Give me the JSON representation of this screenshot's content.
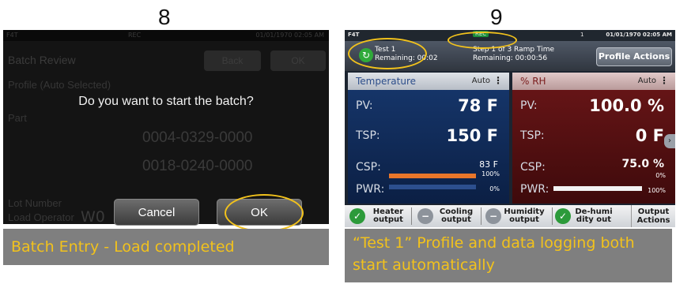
{
  "steps": {
    "left": "8",
    "right": "9"
  },
  "left_panel": {
    "status": {
      "app": "F4T",
      "rec": "REC",
      "datetime": "01/01/1970 02:05 AM"
    },
    "title": "Batch Review",
    "back_label": "Back",
    "ok_bg_label": "OK",
    "fields": {
      "profile_label": "Profile (Auto Selected)",
      "part_label": "Part",
      "part_value_1": "0004-0329-0000",
      "part_value_2": "0018-0240-0000",
      "lot_label": "Lot Number",
      "lot_value": "W0",
      "operator_label": "Load Operator"
    },
    "dialog": {
      "question": "Do you want to start the batch?",
      "cancel_label": "Cancel",
      "ok_label": "OK"
    },
    "caption": "Batch Entry - Load completed"
  },
  "right_panel": {
    "status": {
      "app": "F4T",
      "rec": "REC",
      "usb": "1",
      "datetime": "01/01/1970 02:05 AM"
    },
    "profile": {
      "name": "Test 1",
      "remaining": "Remaining: 00:02",
      "step": "Step 1 of 3 Ramp Time",
      "step_remaining": "Remaining: 00:00:56",
      "actions_label": "Profile Actions"
    },
    "temperature": {
      "title": "Temperature",
      "mode": "Auto",
      "pv_label": "PV:",
      "pv": "78 F",
      "tsp_label": "TSP:",
      "tsp": "150 F",
      "csp_label": "CSP:",
      "csp": "83 F",
      "pwr_label": "PWR:",
      "pwr_heat_pct": "100%",
      "pwr_cool_pct": "0%",
      "heat_fill": 1.0
    },
    "humidity": {
      "title": "% RH",
      "mode": "Auto",
      "pv_label": "PV:",
      "pv": "100.0 %",
      "tsp_label": "TSP:",
      "tsp": "0 F",
      "csp_label": "CSP:",
      "csp": "75.0 %",
      "pwr_label": "PWR:",
      "pwr_top_pct": "0%",
      "pwr_bottom_pct": "100%",
      "bottom_fill": 1.0
    },
    "outputs": [
      {
        "line1": "Heater",
        "line2": "output",
        "state": "on"
      },
      {
        "line1": "Cooling",
        "line2": "output",
        "state": "off"
      },
      {
        "line1": "Humidity",
        "line2": "output",
        "state": "off"
      },
      {
        "line1": "De-humi",
        "line2": "dity out",
        "state": "on"
      }
    ],
    "output_actions": {
      "line1": "Output",
      "line2": "Actions"
    },
    "caption": "“Test 1” Profile and data logging both start automatically"
  },
  "colors": {
    "highlight": "#f2c21c",
    "caption_bg": "#7f7f7f",
    "on_icon": "#2c9a3a",
    "off_icon": "#8d939b"
  }
}
